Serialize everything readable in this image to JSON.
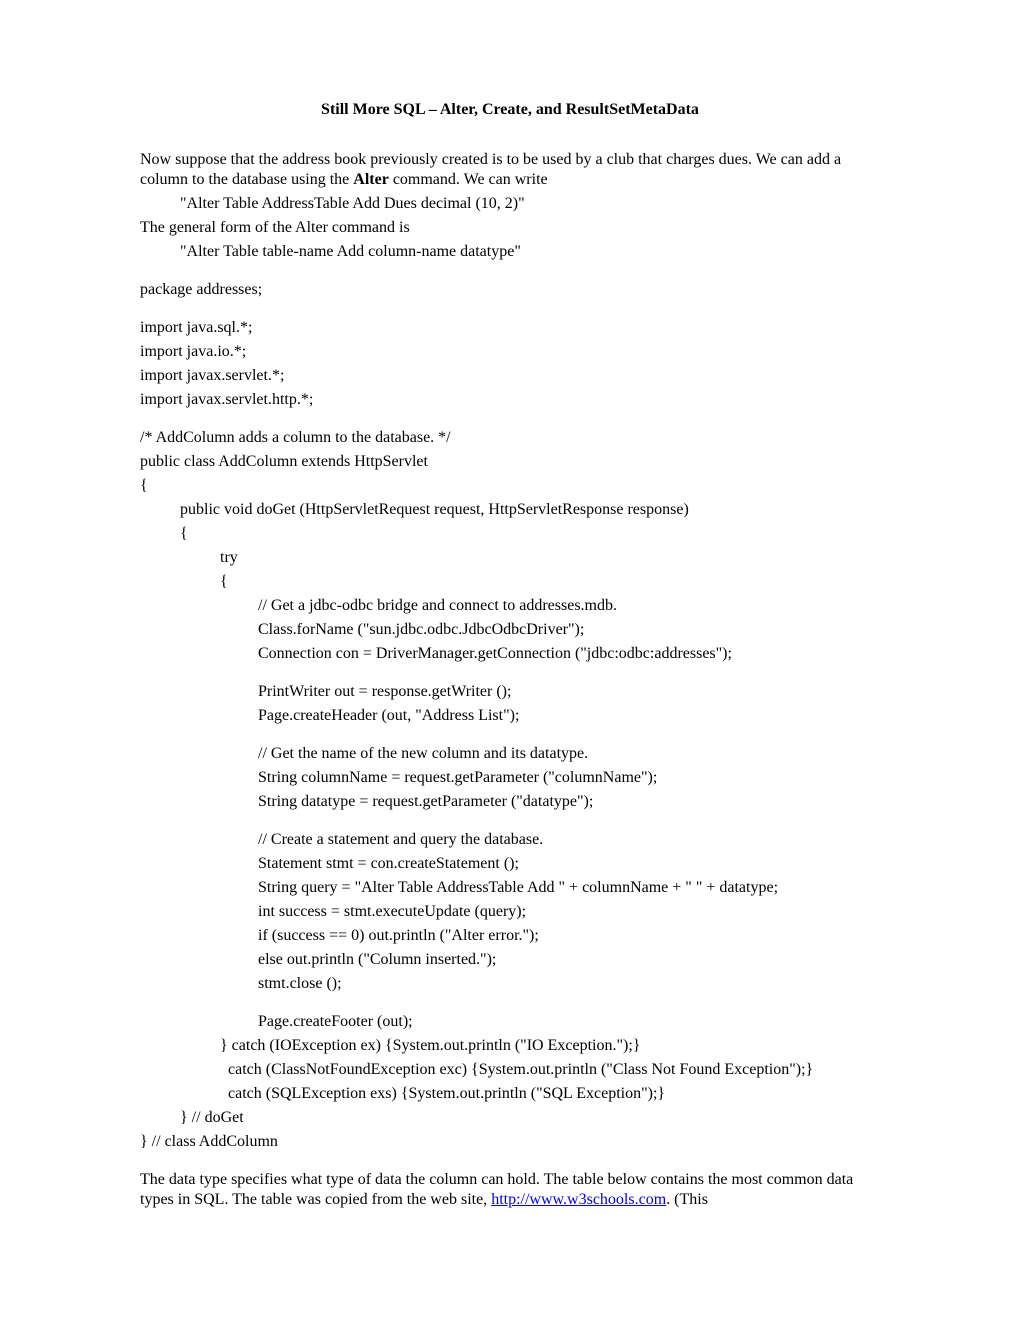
{
  "title": "Still More SQL – Alter, Create, and ResultSetMetaData",
  "intro": {
    "p1a": "Now suppose that the address book previously created is to be used by a club that charges dues.  We can add a column to the database using the ",
    "p1b": "Alter",
    "p1c": " command.  We can write",
    "code1": "\"Alter Table AddressTable Add Dues decimal (10, 2)\"",
    "p2": "The general form of the Alter command is",
    "code2": "\"Alter Table table-name Add column-name datatype\""
  },
  "code": {
    "l1": "package addresses;",
    "l2": "import java.sql.*;",
    "l3": "import java.io.*;",
    "l4": "import javax.servlet.*;",
    "l5": "import javax.servlet.http.*;",
    "l6": "/*     AddColumn adds a column to the database. */",
    "l7": "public class AddColumn extends HttpServlet",
    "l8": "{",
    "l9": "public void doGet (HttpServletRequest request, HttpServletResponse response)",
    "l10": "{",
    "l11": "try",
    "l12": "{",
    "l13": "// Get a jdbc-odbc bridge and connect to addresses.mdb.",
    "l14": "Class.forName (\"sun.jdbc.odbc.JdbcOdbcDriver\");",
    "l15": "Connection con = DriverManager.getConnection (\"jdbc:odbc:addresses\");",
    "l16": "PrintWriter out = response.getWriter ();",
    "l17": "Page.createHeader (out, \"Address List\");",
    "l18": "// Get the name of the new column and its datatype.",
    "l19": "String columnName = request.getParameter (\"columnName\");",
    "l20": "String datatype = request.getParameter (\"datatype\");",
    "l21": "// Create a statement and query the database.",
    "l22": "Statement stmt = con.createStatement ();",
    "l23": "String query = \"Alter Table AddressTable Add \" + columnName + \" \" + datatype;",
    "l24": "int success = stmt.executeUpdate (query);",
    "l25": "if (success == 0) out.println (\"Alter error.\");",
    "l26": "else out.println (\"Column inserted.\");",
    "l27": "stmt.close ();",
    "l28": "Page.createFooter (out);",
    "l29": "} catch (IOException ex) {System.out.println (\"IO Exception.\");}",
    "l30": "  catch (ClassNotFoundException exc) {System.out.println (\"Class Not Found Exception\");}",
    "l31": "  catch (SQLException exs) {System.out.println (\"SQL Exception\");}",
    "l32": "} // doGet",
    "l33": "} // class AddColumn"
  },
  "outro": {
    "p1a": "The data type specifies what type of data the column can hold. The table below contains the most common data types in SQL.  The table was copied from the web site, ",
    "link_text": "http://www.w3schools.com",
    "link_href": "http://www.w3schools.com",
    "p1b": ".   (This"
  }
}
